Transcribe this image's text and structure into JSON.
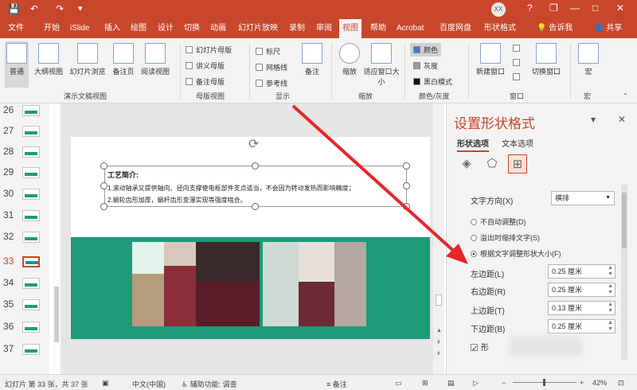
{
  "titlebar": {
    "qa_save": "💾",
    "qa_undo": "↶",
    "qa_redo": "↷",
    "qa_more": "▾",
    "avatar_text": "XX",
    "help_icon": "?",
    "restore": "❐",
    "minimize": "—",
    "maximize": "□",
    "close": "✕"
  },
  "menu": {
    "tabs": [
      "文件",
      "开始",
      "iSlide",
      "插入",
      "绘图",
      "设计",
      "切换",
      "动画",
      "幻灯片放映",
      "录制",
      "审阅",
      "视图",
      "帮助",
      "Acrobat",
      "百度网盘",
      "形状格式"
    ],
    "active_tab": "视图",
    "tell_me": "告诉我",
    "share": "共享"
  },
  "ribbon": {
    "big_buttons": [
      "普通",
      "大纲视图",
      "幻灯片浏览",
      "备注页",
      "阅读视图",
      "备注",
      "缩放",
      "适应窗口大小",
      "新建窗口",
      "切换窗口",
      "宏"
    ],
    "master_items": [
      "幻灯片母版",
      "讲义母版",
      "备注母版"
    ],
    "show_items": [
      "标尺",
      "网格线",
      "参考线"
    ],
    "color_items": [
      "颜色",
      "灰度",
      "黑白模式"
    ],
    "groups": [
      "演示文稿视图",
      "母版视图",
      "显示",
      "缩放",
      "颜色/灰度",
      "窗口",
      "宏"
    ]
  },
  "thumbnails": {
    "numbers": [
      "26",
      "27",
      "28",
      "29",
      "30",
      "31",
      "32",
      "33",
      "34",
      "35",
      "36",
      "37"
    ],
    "selected": "33"
  },
  "slide": {
    "title": "工艺简介:",
    "line1": "1.滚动轴承又提供轴向、径向支撑使电枢部件支点适当，不会因为转动发热而影响精度；",
    "line2": "2.蜗轮齿形加厚，蜗杆齿形变薄实现等强度啮合。"
  },
  "pane": {
    "title": "设置形状格式",
    "tab_shape": "形状选项",
    "tab_text": "文本选项",
    "text_direction_label": "文字方向(X)",
    "text_direction_value": "横排",
    "radio_no_autofit": "不自动调整(D)",
    "radio_shrink": "溢出时缩排文字(S)",
    "radio_resize": "根据文字调整形状大小(F)",
    "left_margin_label": "左边距(L)",
    "left_margin_value": "0.25 厘米",
    "right_margin_label": "右边距(R)",
    "right_margin_value": "0.25 厘米",
    "top_margin_label": "上边距(T)",
    "top_margin_value": "0.13 厘米",
    "bottom_margin_label": "下边距(B)",
    "bottom_margin_value": "0.25 厘米",
    "wrap_label": "形"
  },
  "status": {
    "slide_info": "幻灯片 第 33 张，共 37 张",
    "language": "中文(中国)",
    "accessibility": "辅助功能: 调查",
    "notes": "备注",
    "zoom": "42%"
  },
  "colors": {
    "accent": "#c8462b",
    "slide_band": "#1e9b78",
    "arrow": "#e8262b"
  }
}
